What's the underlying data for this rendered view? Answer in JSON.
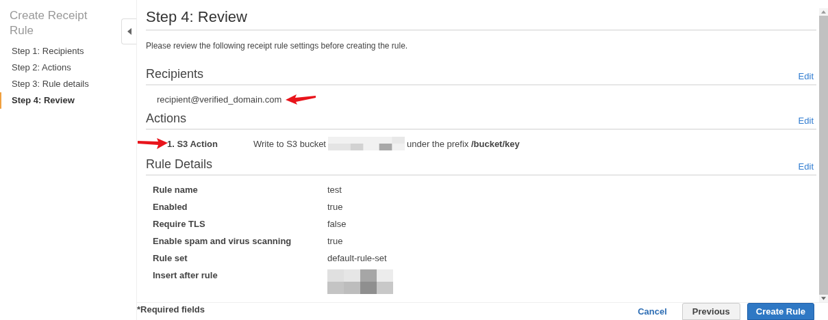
{
  "sidebar": {
    "title": "Create Receipt Rule",
    "steps": [
      {
        "label": "Step 1: Recipients",
        "selected": false
      },
      {
        "label": "Step 2: Actions",
        "selected": false
      },
      {
        "label": "Step 3: Rule details",
        "selected": false
      },
      {
        "label": "Step 4: Review",
        "selected": true
      }
    ]
  },
  "page": {
    "title": "Step 4: Review",
    "description": "Please review the following receipt rule settings before creating the rule."
  },
  "recipients": {
    "heading": "Recipients",
    "edit": "Edit",
    "emails": [
      "recipient@verified_domain.com"
    ]
  },
  "actions": {
    "heading": "Actions",
    "edit": "Edit",
    "items": [
      {
        "name": "1. S3 Action",
        "before": "Write to S3 bucket",
        "redacted": true,
        "after": "under the prefix **/bucket/key**"
      }
    ]
  },
  "rule_details": {
    "heading": "Rule Details",
    "edit": "Edit",
    "rows": [
      {
        "label": "Rule name",
        "value": "test",
        "redacted": false
      },
      {
        "label": "Enabled",
        "value": "true",
        "redacted": false
      },
      {
        "label": "Require TLS",
        "value": "false",
        "redacted": false
      },
      {
        "label": "Enable spam and virus scanning",
        "value": "true",
        "redacted": false
      },
      {
        "label": "Rule set",
        "value": "default-rule-set",
        "redacted": false
      },
      {
        "label": "Insert after rule",
        "redacted": true
      }
    ]
  },
  "footer": {
    "note": "*Required fields",
    "buttons": [
      {
        "label": "Cancel",
        "kind": "link"
      },
      {
        "label": "Previous",
        "kind": "secondary"
      },
      {
        "label": "Create Rule",
        "kind": "primary"
      }
    ]
  }
}
